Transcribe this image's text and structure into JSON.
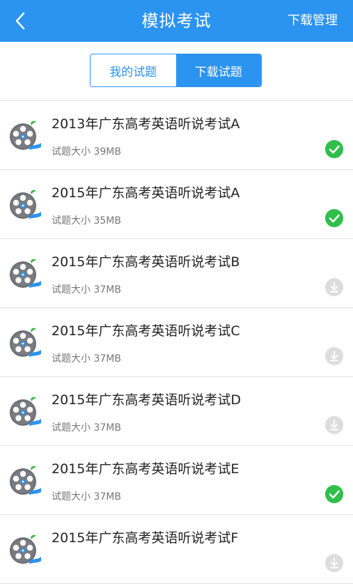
{
  "header": {
    "title": "模拟考试",
    "action_label": "下载管理"
  },
  "tabs": [
    {
      "label": "我的试题",
      "active": false
    },
    {
      "label": "下载试题",
      "active": true
    }
  ],
  "colors": {
    "primary": "#2b93f0",
    "success": "#2fbf4a",
    "disabled": "#dddddd"
  },
  "items": [
    {
      "title": "2013年广东高考英语听说考试A",
      "size": "试题大小 39MB",
      "status": "downloaded"
    },
    {
      "title": "2015年广东高考英语听说考试A",
      "size": "试题大小 35MB",
      "status": "downloaded"
    },
    {
      "title": "2015年广东高考英语听说考试B",
      "size": "试题大小 37MB",
      "status": "not-downloaded"
    },
    {
      "title": "2015年广东高考英语听说考试C",
      "size": "试题大小 37MB",
      "status": "not-downloaded"
    },
    {
      "title": "2015年广东高考英语听说考试D",
      "size": "试题大小 37MB",
      "status": "not-downloaded"
    },
    {
      "title": "2015年广东高考英语听说考试E",
      "size": "试题大小 37MB",
      "status": "downloaded"
    },
    {
      "title": "2015年广东高考英语听说考试F",
      "size": "",
      "status": "not-downloaded"
    }
  ]
}
